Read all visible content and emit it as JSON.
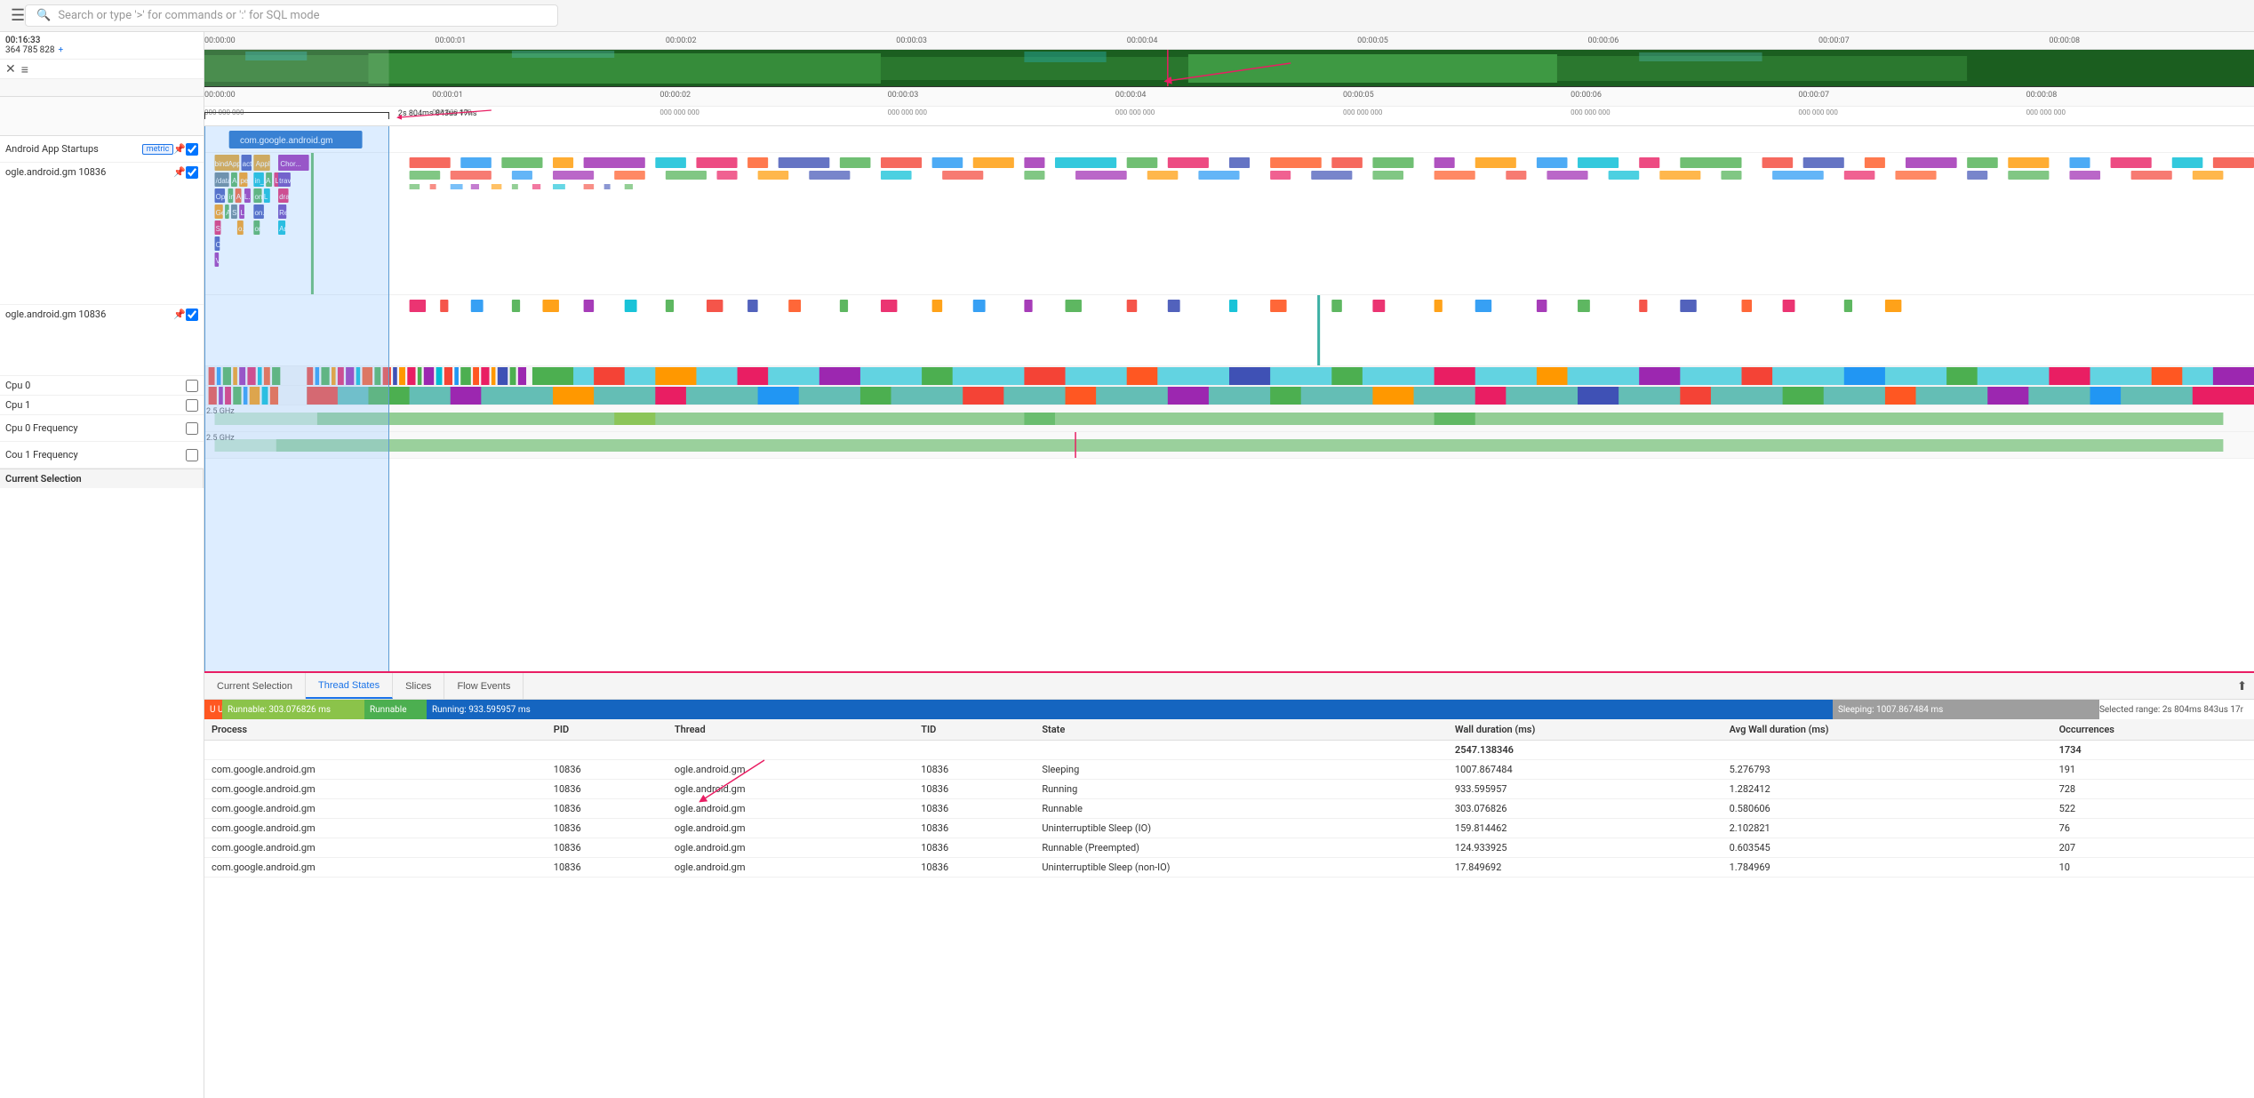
{
  "header": {
    "search_placeholder": "Search or type '>' for commands or ':' for SQL mode"
  },
  "time_info": {
    "time": "00:16:33",
    "frame": "364 785 828"
  },
  "tracks": [
    {
      "name": "Android App Startups",
      "has_metric": true,
      "has_pin": true,
      "has_checkbox": true,
      "class": "app-startups"
    },
    {
      "name": "ogle.android.gm 10836",
      "has_metric": false,
      "has_pin": true,
      "has_checkbox": true,
      "class": "ogle-main"
    },
    {
      "name": "ogle.android.gm 10836",
      "has_metric": false,
      "has_pin": true,
      "has_checkbox": true,
      "class": "ogle-second"
    },
    {
      "name": "Cpu 0",
      "has_metric": false,
      "has_pin": false,
      "has_checkbox": true,
      "class": "cpu0"
    },
    {
      "name": "Cpu 1",
      "has_metric": false,
      "has_pin": false,
      "has_checkbox": true,
      "class": "cpu1"
    },
    {
      "name": "Cpu 0 Frequency",
      "has_metric": false,
      "has_pin": false,
      "has_checkbox": true,
      "class": "cpu0-freq",
      "freq": "2.5 GHz"
    },
    {
      "name": "Cou 1 Frequency",
      "has_metric": false,
      "has_pin": false,
      "has_checkbox": true,
      "class": "cpu1-freq",
      "freq": "2.5 GHz"
    }
  ],
  "overview_ruler_ticks": [
    "00:00:00",
    "00:00:01",
    "00:00:02",
    "00:00:03",
    "00:00:04",
    "00:00:05",
    "00:00:06",
    "00:00:07",
    "00:00:08"
  ],
  "detail_ruler_ticks": [
    {
      "label": "00:00:00",
      "sub": "000 000 000"
    },
    {
      "label": "00:00:01",
      "sub": "000 000 000"
    },
    {
      "label": "00:00:02",
      "sub": "000 000 000"
    },
    {
      "label": "00:00:03",
      "sub": "000 000 000"
    },
    {
      "label": "00:00:04",
      "sub": "000 000 000"
    },
    {
      "label": "00:00:05",
      "sub": "000 000 000"
    },
    {
      "label": "00:00:06",
      "sub": "000 000 000"
    },
    {
      "label": "00:00:07",
      "sub": "000 000 000"
    },
    {
      "label": "00:00:08",
      "sub": "000 000 000"
    }
  ],
  "duration_label": "2s 804ms 843us 17ns",
  "tabs": {
    "items": [
      "Current Selection",
      "Thread States",
      "Slices",
      "Flow Events"
    ],
    "active": "Thread States"
  },
  "thread_states": {
    "uninterruptible_label": "U Uninterruptible",
    "runnable_waiting_label": "Runnable: 303.076826 ms",
    "runnable_label": "Runnable",
    "running_label": "Running: 933.595957 ms",
    "sleeping_label": "Sleeping: 1007.867484 ms",
    "selected_range": "Selected range: 2s 804ms 843us 17r"
  },
  "table": {
    "headers": [
      "Process",
      "PID",
      "Thread",
      "TID",
      "State",
      "Wall duration (ms)",
      "Avg Wall duration (ms)",
      "Occurrences"
    ],
    "total_row": {
      "wall": "2547.138346",
      "occurrences": "1734"
    },
    "rows": [
      {
        "process": "com.google.android.gm",
        "pid": "10836",
        "thread": "ogle.android.gm",
        "tid": "10836",
        "state": "Sleeping",
        "wall": "1007.867484",
        "avg_wall": "5.276793",
        "occurrences": "191"
      },
      {
        "process": "com.google.android.gm",
        "pid": "10836",
        "thread": "ogle.android.gm",
        "tid": "10836",
        "state": "Running",
        "wall": "933.595957",
        "avg_wall": "1.282412",
        "occurrences": "728"
      },
      {
        "process": "com.google.android.gm",
        "pid": "10836",
        "thread": "ogle.android.gm",
        "tid": "10836",
        "state": "Runnable",
        "wall": "303.076826",
        "avg_wall": "0.580606",
        "occurrences": "522"
      },
      {
        "process": "com.google.android.gm",
        "pid": "10836",
        "thread": "ogle.android.gm",
        "tid": "10836",
        "state": "Uninterruptible Sleep (IO)",
        "wall": "159.814462",
        "avg_wall": "2.102821",
        "occurrences": "76"
      },
      {
        "process": "com.google.android.gm",
        "pid": "10836",
        "thread": "ogle.android.gm",
        "tid": "10836",
        "state": "Runnable (Preempted)",
        "wall": "124.933925",
        "avg_wall": "0.603545",
        "occurrences": "207"
      },
      {
        "process": "com.google.android.gm",
        "pid": "10836",
        "thread": "ogle.android.gm",
        "tid": "10836",
        "state": "Uninterruptible Sleep (non-IO)",
        "wall": "17.849692",
        "avg_wall": "1.784969",
        "occurrences": "10"
      }
    ]
  },
  "app_block_label": "com.google.android.gm",
  "slice_labels": [
    "bindApplicat...",
    "act...",
    "Appli...",
    "/data...",
    "A...",
    "pe...",
    "OpenD...",
    "in_...",
    "A",
    "L...",
    "Ge...",
    "A",
    "S...",
    "L...",
    "on...",
    "L",
    "St...",
    "o...",
    "on...",
    "O...",
    "V",
    "Chor...",
    "trav...",
    "draw",
    "Rec...",
    "An..."
  ],
  "current_selection_label": "Current Selection",
  "colors": {
    "accent": "#e91e63",
    "running": "#1565c0",
    "sleeping": "#9e9e9e",
    "runnable": "#4caf50",
    "runnable_waiting": "#8bc34a",
    "uninterruptible": "#ff5722",
    "brand_green": "#2e7d32"
  }
}
